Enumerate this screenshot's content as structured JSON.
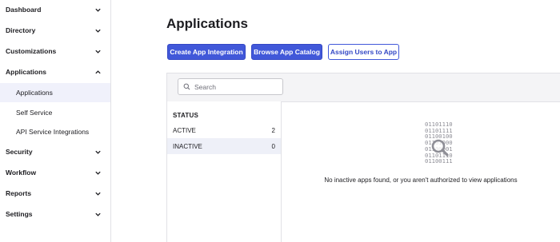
{
  "sidebar": {
    "sections": [
      {
        "label": "Dashboard",
        "expanded": false
      },
      {
        "label": "Directory",
        "expanded": false
      },
      {
        "label": "Customizations",
        "expanded": false
      },
      {
        "label": "Applications",
        "expanded": true
      },
      {
        "label": "Security",
        "expanded": false
      },
      {
        "label": "Workflow",
        "expanded": false
      },
      {
        "label": "Reports",
        "expanded": false
      },
      {
        "label": "Settings",
        "expanded": false
      }
    ],
    "applications_items": [
      {
        "label": "Applications",
        "active": true
      },
      {
        "label": "Self Service",
        "active": false
      },
      {
        "label": "API Service Integrations",
        "active": false
      }
    ]
  },
  "main": {
    "title": "Applications",
    "buttons": {
      "create": "Create App Integration",
      "browse": "Browse App Catalog",
      "assign": "Assign Users to App"
    },
    "search": {
      "placeholder": "Search"
    },
    "status": {
      "title": "STATUS",
      "rows": [
        {
          "label": "ACTIVE",
          "count": "2",
          "selected": false
        },
        {
          "label": "INACTIVE",
          "count": "0",
          "selected": true
        }
      ]
    },
    "empty": {
      "binary": [
        "01101110",
        "01101111",
        "01100100",
        "01101000",
        "01100001",
        "01101110",
        "01100111"
      ],
      "message": "No inactive apps found, or you aren't authorized to view applications"
    }
  },
  "colors": {
    "primary": "#4158d9",
    "selected_bg": "#eef0f8",
    "toolbar_bg": "#f4f4f6"
  }
}
